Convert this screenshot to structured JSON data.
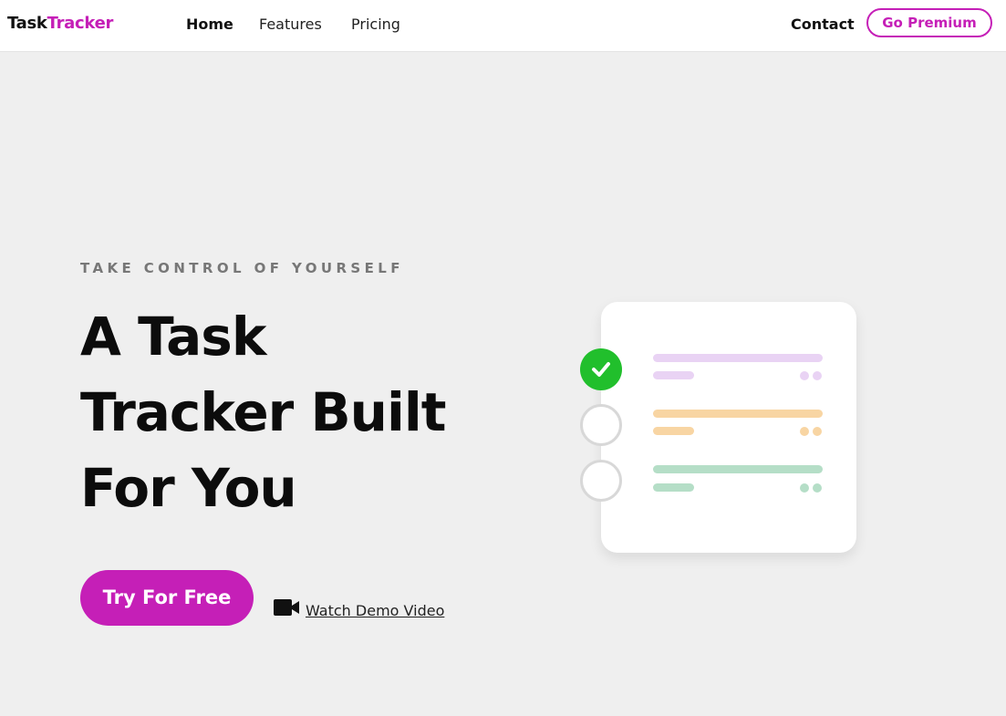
{
  "nav": {
    "logo_part1": "Task",
    "logo_part2": "Tracker",
    "links": [
      "Home",
      "Features",
      "Pricing"
    ],
    "contact": "Contact",
    "premium": "Go Premium"
  },
  "hero": {
    "eyebrow": "TAKE CONTROL OF YOURSELF",
    "headline_lines": [
      "A Task",
      "Tracker Built",
      "For You"
    ],
    "cta": "Try For Free",
    "demo": "Watch Demo Video"
  },
  "illustration": {
    "tasks": [
      {
        "done": true,
        "color": "#e9d3f4"
      },
      {
        "done": false,
        "color": "#f8d5a3"
      },
      {
        "done": false,
        "color": "#b5dec7"
      }
    ]
  },
  "colors": {
    "brand": "#c51fb7",
    "check": "#21bf2c",
    "background": "#efefef"
  },
  "icons": [
    "check-icon",
    "video-camera-icon"
  ]
}
